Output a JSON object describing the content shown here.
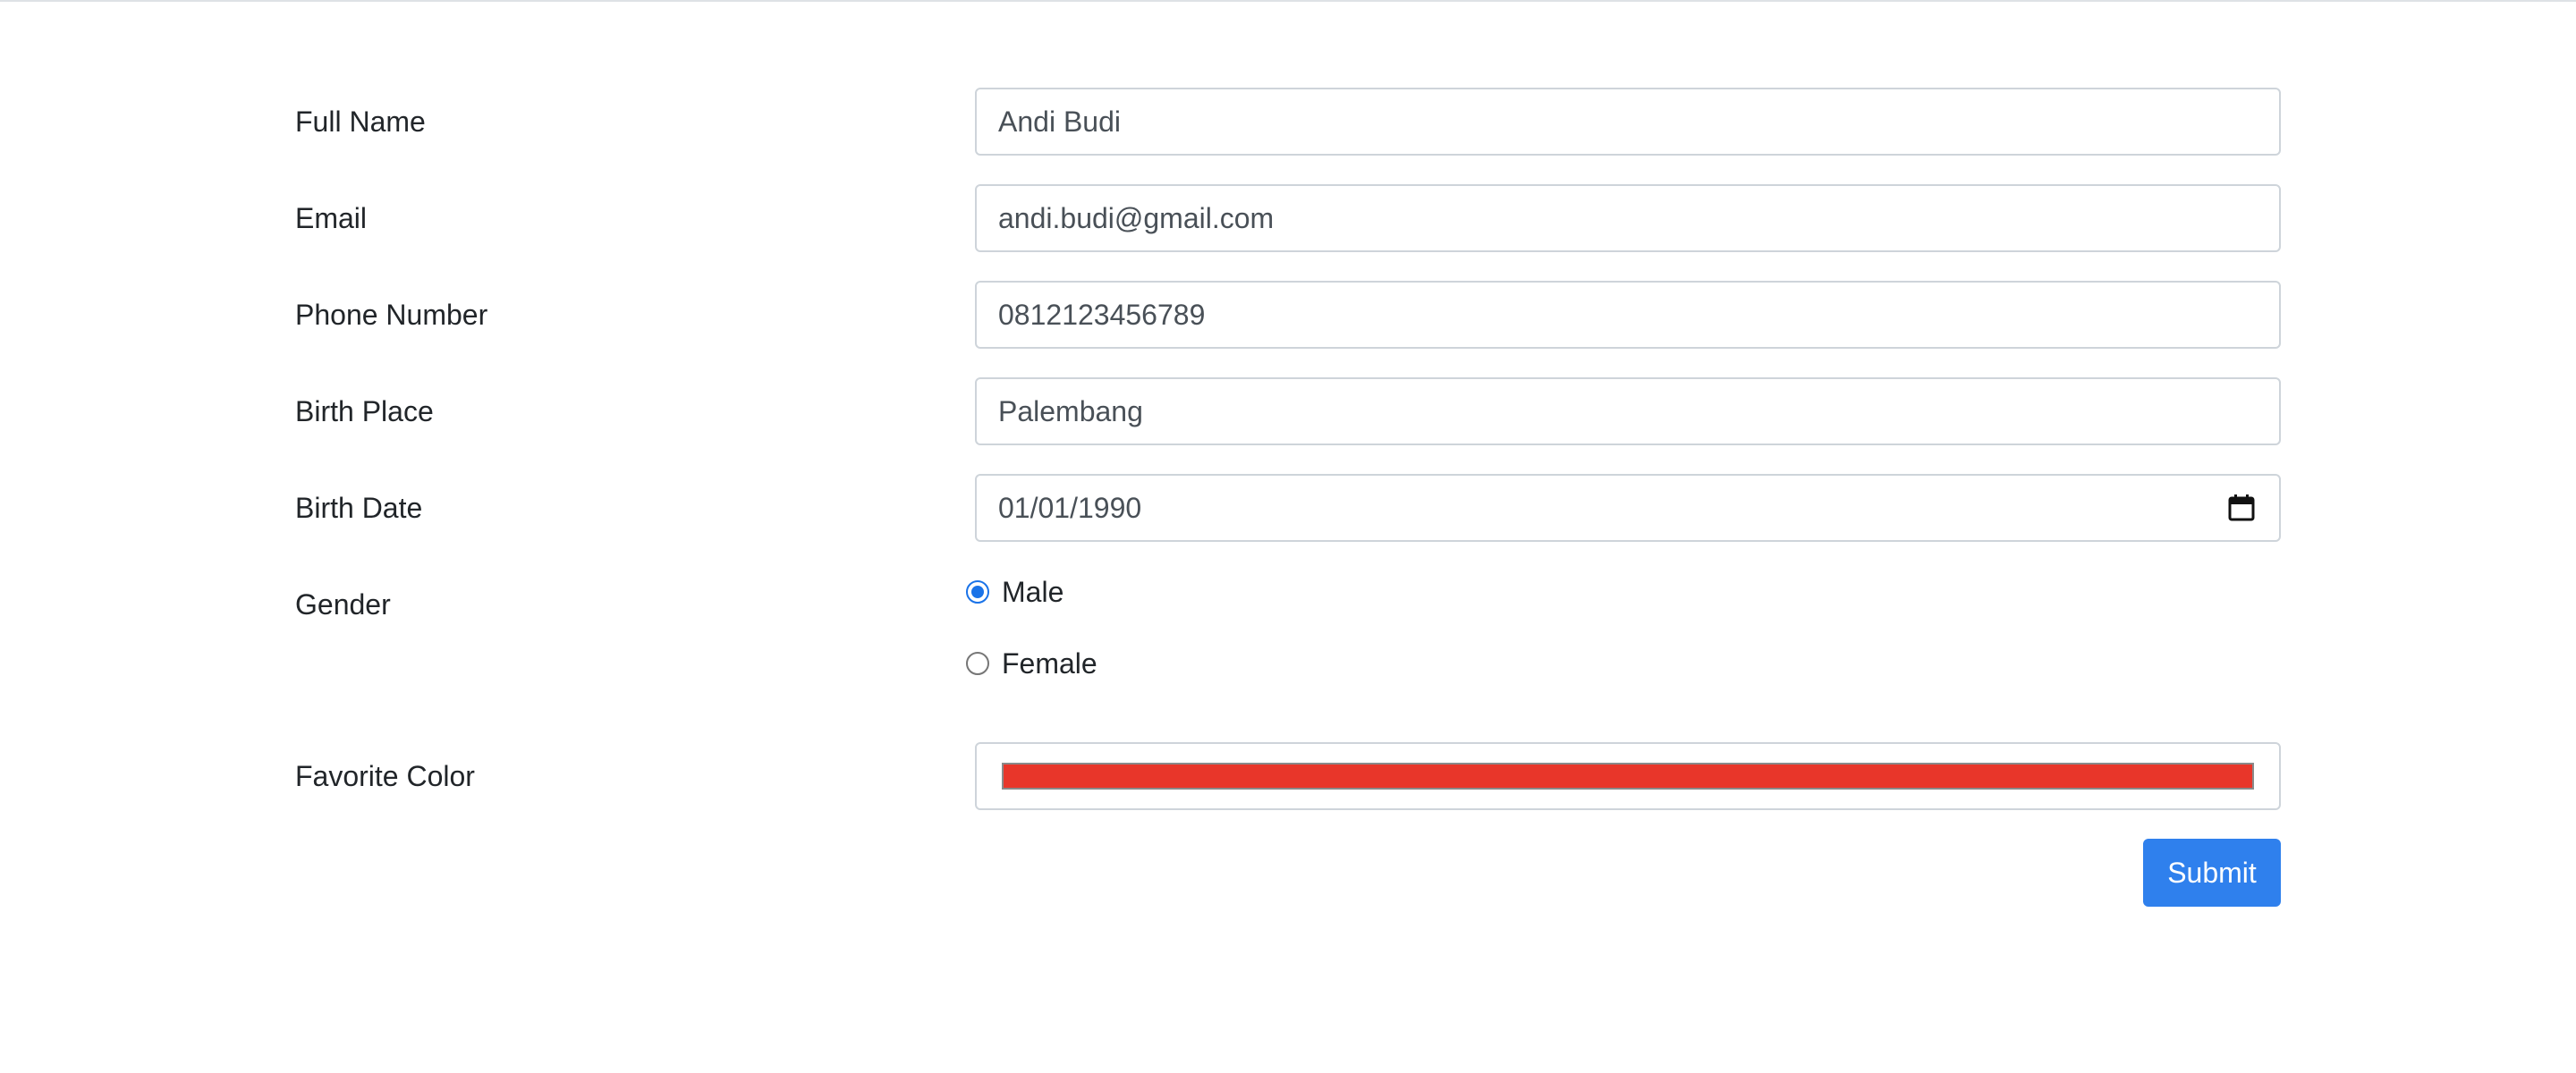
{
  "form": {
    "full_name": {
      "label": "Full Name",
      "value": "Andi Budi"
    },
    "email": {
      "label": "Email",
      "value": "andi.budi@gmail.com"
    },
    "phone": {
      "label": "Phone Number",
      "value": "0812123456789"
    },
    "birth_place": {
      "label": "Birth Place",
      "value": "Palembang"
    },
    "birth_date": {
      "label": "Birth Date",
      "value": "01/01/1990",
      "icon": "calendar-icon"
    },
    "gender": {
      "label": "Gender",
      "options": [
        {
          "label": "Male",
          "checked": true
        },
        {
          "label": "Female",
          "checked": false
        }
      ]
    },
    "favorite_color": {
      "label": "Favorite Color",
      "value": "#e8362a"
    },
    "submit_label": "Submit"
  },
  "colors": {
    "accent": "#2f80ed",
    "radio_checked": "#1a73e8",
    "border": "#ced4da"
  }
}
